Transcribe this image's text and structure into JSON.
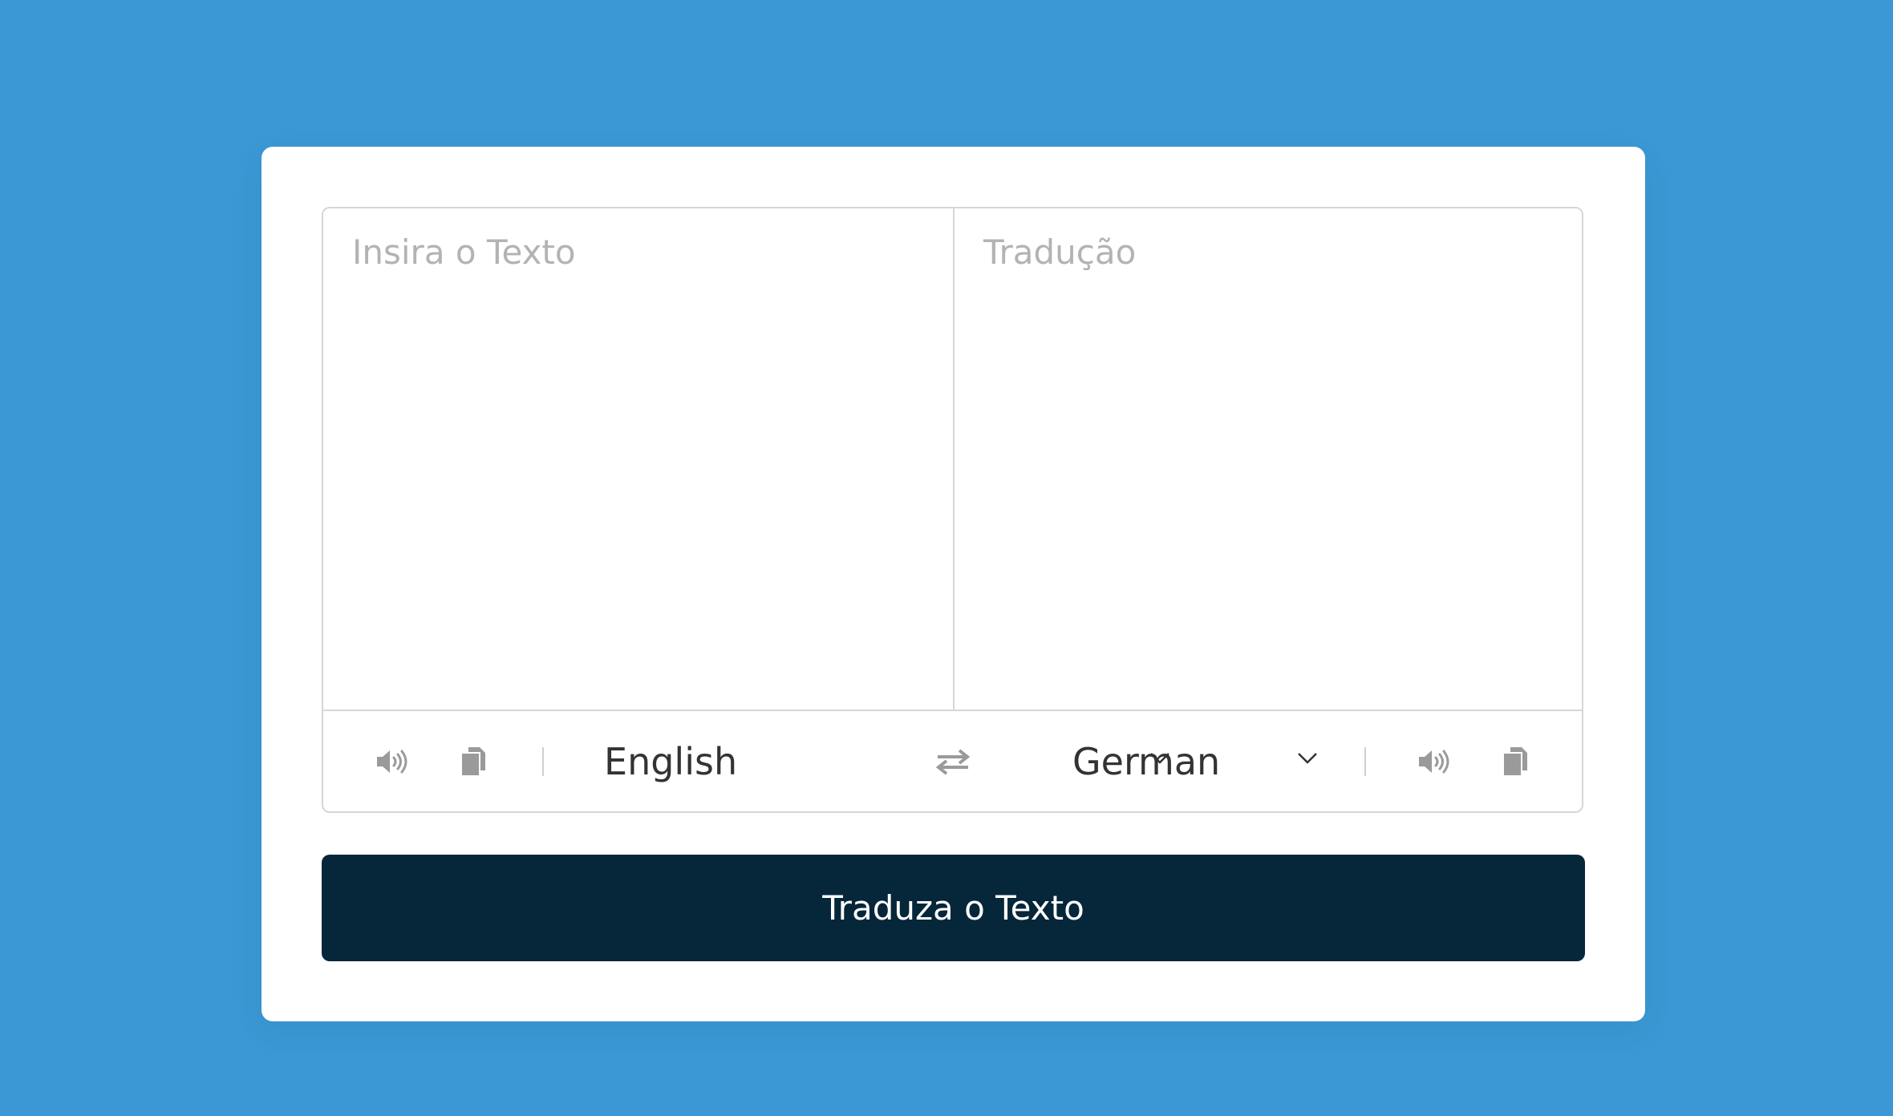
{
  "input": {
    "from_placeholder": "Insira o Texto",
    "from_value": "",
    "to_placeholder": "Tradução",
    "to_value": ""
  },
  "controls": {
    "from_language": "English",
    "to_language": "German",
    "icons": {
      "speak": "volume-icon",
      "copy": "copy-icon",
      "exchange": "exchange-icon",
      "dropdown": "chevron-down-icon"
    }
  },
  "button": {
    "label": "Traduza o Texto"
  },
  "colors": {
    "background": "#3b98d4",
    "card": "#ffffff",
    "button": "#06263a",
    "icon": "#9a9a9a",
    "border": "#d6d6d6",
    "placeholder": "#b3b3b3"
  }
}
